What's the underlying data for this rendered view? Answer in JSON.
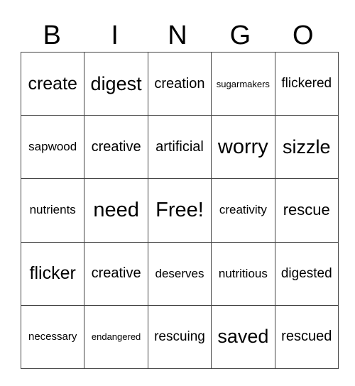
{
  "header": [
    "B",
    "I",
    "N",
    "G",
    "O"
  ],
  "rows": [
    [
      "create",
      "digest",
      "creation",
      "sugarmakers",
      "flickered"
    ],
    [
      "sapwood",
      "creative",
      "artificial",
      "worry",
      "sizzle"
    ],
    [
      "nutrients",
      "need",
      "Free!",
      "creativity",
      "rescue"
    ],
    [
      "flicker",
      "creative",
      "deserves",
      "nutritious",
      "digested"
    ],
    [
      "necessary",
      "endangered",
      "rescuing",
      "saved",
      "rescued"
    ]
  ]
}
